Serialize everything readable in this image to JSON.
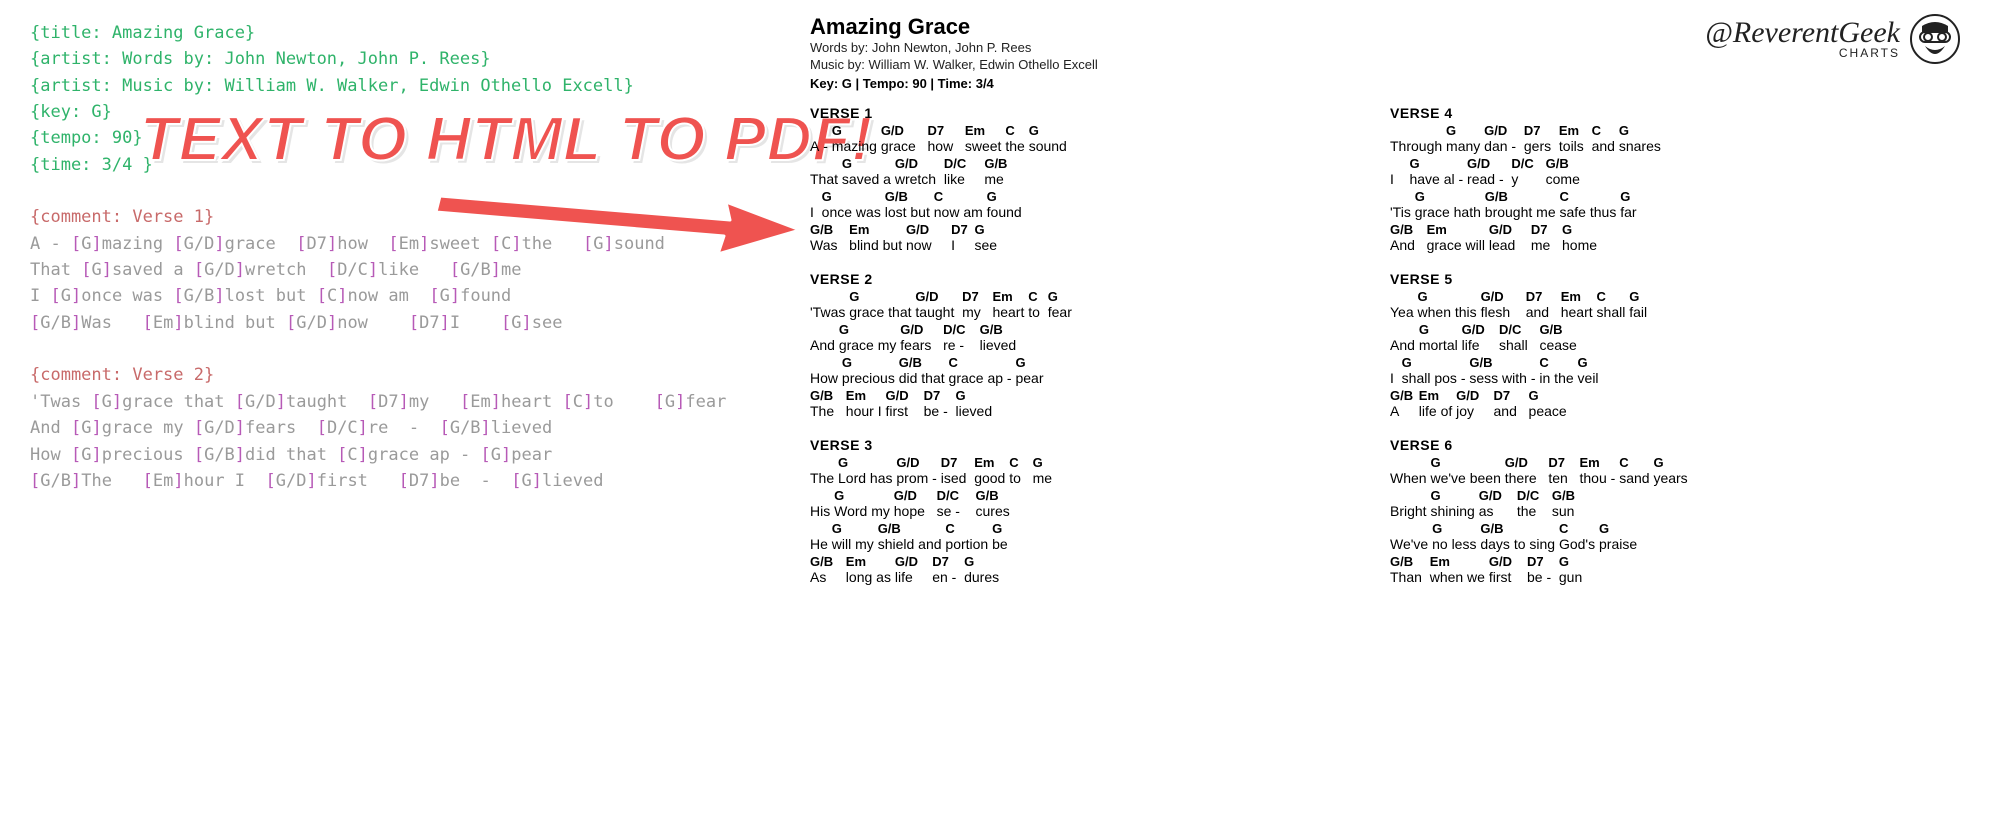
{
  "callout_text": "TEXT TO HTML TO PDF!",
  "logo": {
    "handle": "@ReverentGeek",
    "sub": "CHARTS"
  },
  "source": {
    "meta": [
      "{title: Amazing Grace}",
      "{artist: Words by: John Newton, John P. Rees}",
      "{artist: Music by: William W. Walker, Edwin Othello Excell}",
      "{key: G}",
      "{tempo: 90}",
      "{time: 3/4 }"
    ],
    "sections": [
      {
        "comment": "{comment: Verse 1}",
        "lines": [
          [
            [
              "",
              "A - "
            ],
            [
              "G",
              "mazing "
            ],
            [
              "G/D",
              "grace  "
            ],
            [
              "D7",
              "how  "
            ],
            [
              "Em",
              "sweet "
            ],
            [
              "C",
              "the   "
            ],
            [
              "G",
              "sound"
            ]
          ],
          [
            [
              "",
              "That "
            ],
            [
              "G",
              "saved a "
            ],
            [
              "G/D",
              "wretch  "
            ],
            [
              "D/C",
              "like   "
            ],
            [
              "G/B",
              "me"
            ]
          ],
          [
            [
              "",
              "I "
            ],
            [
              "G",
              "once was "
            ],
            [
              "G/B",
              "lost but "
            ],
            [
              "C",
              "now am  "
            ],
            [
              "G",
              "found"
            ]
          ],
          [
            [
              "G/B",
              "Was   "
            ],
            [
              "Em",
              "blind but "
            ],
            [
              "G/D",
              "now    "
            ],
            [
              "D7",
              "I    "
            ],
            [
              "G",
              "see"
            ]
          ]
        ]
      },
      {
        "comment": "{comment: Verse 2}",
        "lines": [
          [
            [
              "",
              "'Twas "
            ],
            [
              "G",
              "grace that "
            ],
            [
              "G/D",
              "taught  "
            ],
            [
              "D7",
              "my   "
            ],
            [
              "Em",
              "heart "
            ],
            [
              "C",
              "to    "
            ],
            [
              "G",
              "fear"
            ]
          ],
          [
            [
              "",
              "And "
            ],
            [
              "G",
              "grace my "
            ],
            [
              "G/D",
              "fears  "
            ],
            [
              "D/C",
              "re  -  "
            ],
            [
              "G/B",
              "lieved"
            ]
          ],
          [
            [
              "",
              "How "
            ],
            [
              "G",
              "precious "
            ],
            [
              "G/B",
              "did that "
            ],
            [
              "C",
              "grace ap - "
            ],
            [
              "G",
              "pear"
            ]
          ],
          [
            [
              "G/B",
              "The   "
            ],
            [
              "Em",
              "hour I  "
            ],
            [
              "G/D",
              "first   "
            ],
            [
              "D7",
              "be  -  "
            ],
            [
              "G",
              "lieved"
            ]
          ]
        ]
      }
    ]
  },
  "chart": {
    "title": "Amazing Grace",
    "words_by": "Words by: John Newton, John P. Rees",
    "music_by": "Music by: William W. Walker, Edwin Othello Excell",
    "keyline": "Key: G | Tempo: 90 | Time: 3/4",
    "columns": [
      [
        {
          "label": "VERSE 1",
          "lines": [
            [
              [
                "",
                "A - "
              ],
              [
                "G",
                "mazing "
              ],
              [
                "G/D",
                "grace   "
              ],
              [
                "D7",
                "how   "
              ],
              [
                "Em",
                "sweet "
              ],
              [
                "C",
                "the "
              ],
              [
                "G",
                "sound"
              ]
            ],
            [
              [
                "",
                "That "
              ],
              [
                "G",
                "saved a "
              ],
              [
                "G/D",
                "wretch  "
              ],
              [
                "D/C",
                "like     "
              ],
              [
                "G/B",
                "me"
              ]
            ],
            [
              [
                "",
                "I  "
              ],
              [
                "G",
                "once was "
              ],
              [
                "G/B",
                "lost but "
              ],
              [
                "C",
                "now am "
              ],
              [
                "G",
                "found"
              ]
            ],
            [
              [
                "G/B",
                "Was   "
              ],
              [
                "Em",
                "blind but "
              ],
              [
                "G/D",
                "now     "
              ],
              [
                "D7",
                "I     "
              ],
              [
                "G",
                "see"
              ]
            ]
          ]
        },
        {
          "label": "VERSE 2",
          "lines": [
            [
              [
                "",
                "'Twas "
              ],
              [
                "G",
                "grace that "
              ],
              [
                "G/D",
                "taught  "
              ],
              [
                "D7",
                "my   "
              ],
              [
                "Em",
                "heart "
              ],
              [
                "C",
                "to  "
              ],
              [
                "G",
                "fear"
              ]
            ],
            [
              [
                "",
                "And "
              ],
              [
                "G",
                "grace my "
              ],
              [
                "G/D",
                "fears   "
              ],
              [
                "D/C",
                "re -    "
              ],
              [
                "G/B",
                "lieved"
              ]
            ],
            [
              [
                "",
                "How "
              ],
              [
                "G",
                "precious "
              ],
              [
                "G/B",
                "did that "
              ],
              [
                "C",
                "grace ap - "
              ],
              [
                "G",
                "pear"
              ]
            ],
            [
              [
                "G/B",
                "The   "
              ],
              [
                "Em",
                "hour I "
              ],
              [
                "G/D",
                "first    "
              ],
              [
                "D7",
                "be -  "
              ],
              [
                "G",
                "lieved"
              ]
            ]
          ]
        },
        {
          "label": "VERSE 3",
          "lines": [
            [
              [
                "",
                "The "
              ],
              [
                "G",
                "Lord has "
              ],
              [
                "G/D",
                "prom - "
              ],
              [
                "D7",
                "ised  "
              ],
              [
                "Em",
                "good "
              ],
              [
                "C",
                "to   "
              ],
              [
                "G",
                "me"
              ]
            ],
            [
              [
                "",
                "His "
              ],
              [
                "G",
                "Word my "
              ],
              [
                "G/D",
                "hope   "
              ],
              [
                "D/C",
                "se -    "
              ],
              [
                "G/B",
                "cures"
              ]
            ],
            [
              [
                "",
                "He "
              ],
              [
                "G",
                "will my "
              ],
              [
                "G/B",
                "shield and "
              ],
              [
                "C",
                "portion "
              ],
              [
                "G",
                "be"
              ]
            ],
            [
              [
                "G/B",
                "As     "
              ],
              [
                "Em",
                "long as "
              ],
              [
                "G/D",
                "life     "
              ],
              [
                "D7",
                "en -  "
              ],
              [
                "G",
                "dures"
              ]
            ]
          ]
        }
      ],
      [
        {
          "label": "VERSE 4",
          "lines": [
            [
              [
                "",
                "Through "
              ],
              [
                "G",
                "many "
              ],
              [
                "G/D",
                "dan -  "
              ],
              [
                "D7",
                "gers  "
              ],
              [
                "Em",
                "toils  "
              ],
              [
                "C",
                "and "
              ],
              [
                "G",
                "snares"
              ]
            ],
            [
              [
                "",
                "I    "
              ],
              [
                "G",
                "have al - "
              ],
              [
                "G/D",
                "read -  "
              ],
              [
                "D/C",
                "y       "
              ],
              [
                "G/B",
                "come"
              ]
            ],
            [
              [
                "",
                "'Tis "
              ],
              [
                "G",
                "grace hath "
              ],
              [
                "G/B",
                "brought me "
              ],
              [
                "C",
                "safe thus "
              ],
              [
                "G",
                "far"
              ]
            ],
            [
              [
                "G/B",
                "And   "
              ],
              [
                "Em",
                "grace will "
              ],
              [
                "G/D",
                "lead    "
              ],
              [
                "D7",
                "me   "
              ],
              [
                "G",
                "home"
              ]
            ]
          ]
        },
        {
          "label": "VERSE 5",
          "lines": [
            [
              [
                "",
                "Yea "
              ],
              [
                "G",
                "when this "
              ],
              [
                "G/D",
                "flesh    "
              ],
              [
                "D7",
                "and   "
              ],
              [
                "Em",
                "heart "
              ],
              [
                "C",
                "shall "
              ],
              [
                "G",
                "fail"
              ]
            ],
            [
              [
                "",
                "And "
              ],
              [
                "G",
                "mortal "
              ],
              [
                "G/D",
                "life     "
              ],
              [
                "D/C",
                "shall   "
              ],
              [
                "G/B",
                "cease"
              ]
            ],
            [
              [
                "",
                "I  "
              ],
              [
                "G",
                "shall pos - "
              ],
              [
                "G/B",
                "sess with - "
              ],
              [
                "C",
                "in the "
              ],
              [
                "G",
                "veil"
              ]
            ],
            [
              [
                "G/B",
                "A     "
              ],
              [
                "Em",
                "life of "
              ],
              [
                "G/D",
                "joy     "
              ],
              [
                "D7",
                "and   "
              ],
              [
                "G",
                "peace"
              ]
            ]
          ]
        },
        {
          "label": "VERSE 6",
          "lines": [
            [
              [
                "",
                "When "
              ],
              [
                "G",
                "we've been "
              ],
              [
                "G/D",
                "there   "
              ],
              [
                "D7",
                "ten   "
              ],
              [
                "Em",
                "thou - "
              ],
              [
                "C",
                "sand "
              ],
              [
                "G",
                "years"
              ]
            ],
            [
              [
                "",
                "Bright "
              ],
              [
                "G",
                "shining "
              ],
              [
                "G/D",
                "as      "
              ],
              [
                "D/C",
                "the    "
              ],
              [
                "G/B",
                "sun"
              ]
            ],
            [
              [
                "",
                "We've "
              ],
              [
                "G",
                "no less "
              ],
              [
                "G/B",
                "days to sing "
              ],
              [
                "C",
                "God's "
              ],
              [
                "G",
                "praise"
              ]
            ],
            [
              [
                "G/B",
                "Than  "
              ],
              [
                "Em",
                "when we "
              ],
              [
                "G/D",
                "first    "
              ],
              [
                "D7",
                "be -  "
              ],
              [
                "G",
                "gun"
              ]
            ]
          ]
        }
      ]
    ]
  }
}
